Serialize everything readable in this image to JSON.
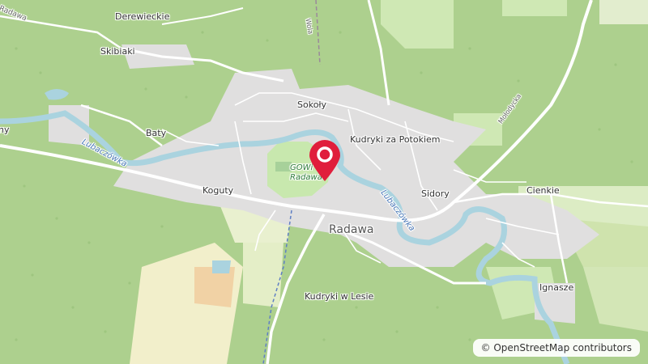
{
  "map": {
    "places": {
      "radawa_top": "Radawa",
      "derewieckie": "Derewieckie",
      "skibiaki": "Skibiaki",
      "sokoly": "Sokoły",
      "baty": "Baty",
      "left_edge": "ny",
      "kudryki_za_potokiem": "Kudryki za Potokiem",
      "koguty": "Koguty",
      "sidory": "Sidory",
      "cienkie": "Cienkie",
      "radawa": "Radawa",
      "ignasze": "Ignasze",
      "kudryki_w_lesie": "Kudryki w Lesie"
    },
    "rivers": {
      "west": "Lubaczówka",
      "east": "Lubaczówka"
    },
    "park": {
      "line1": "GOWi",
      "line2": "Radawa"
    },
    "roads": {
      "molodycka": "Mołodycka",
      "wola": "Wola"
    },
    "marker": {
      "icon": "location-pin-icon",
      "color": "#e01e3c"
    },
    "attribution": "© OpenStreetMap contributors"
  }
}
